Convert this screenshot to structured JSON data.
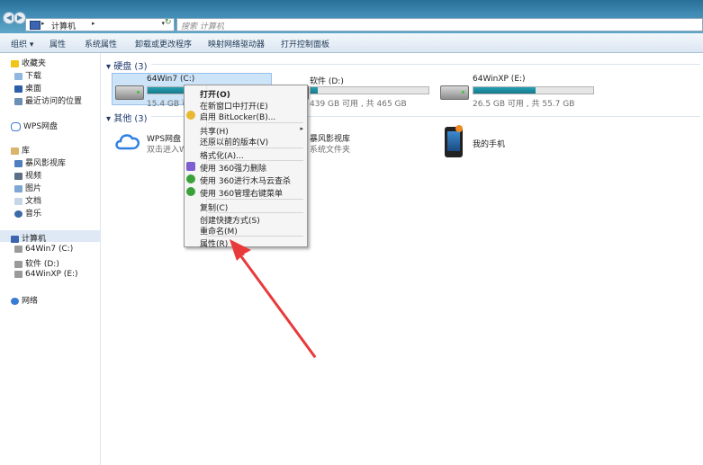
{
  "address": {
    "path_root": "计算机",
    "search_placeholder": "搜索 计算机"
  },
  "toolbar": {
    "organize": "组织",
    "properties": "属性",
    "system_properties": "系统属性",
    "uninstall": "卸载或更改程序",
    "map_drive": "映射网络驱动器",
    "control_panel": "打开控制面板"
  },
  "sidebar": {
    "favorites": "收藏夹",
    "downloads": "下载",
    "desktop": "桌面",
    "recent": "最近访问的位置",
    "wps_cloud": "WPS网盘",
    "libraries": "库",
    "storm_video": "暴风影视库",
    "videos": "视频",
    "pictures": "图片",
    "documents": "文档",
    "music": "音乐",
    "computer": "计算机",
    "drive_c": "64Win7  (C:)",
    "drive_d": "软件 (D:)",
    "drive_e": "64WinXP  (E:)",
    "network": "网络"
  },
  "main": {
    "hard_disks_header": "硬盘 (3)",
    "other_header": "其他 (3)",
    "drives": [
      {
        "name": "64Win7  (C:)",
        "free": "15.4 GB 可",
        "usage": 0.7
      },
      {
        "name": "软件 (D:)",
        "free": "439 GB 可用 , 共 465 GB",
        "usage": 0.06
      },
      {
        "name": "64WinXP  (E:)",
        "free": "26.5 GB 可用 , 共 55.7 GB",
        "usage": 0.52
      }
    ],
    "others": [
      {
        "name": "WPS网盘",
        "sub": "双击进入W"
      },
      {
        "name": "暴风影视库",
        "sub": "系统文件夹"
      },
      {
        "name": "我的手机",
        "sub": ""
      }
    ]
  },
  "context_menu": {
    "open": "打开(O)",
    "open_new_window": "在新窗口中打开(E)",
    "bitlocker": "启用 BitLocker(B)...",
    "share": "共享(H)",
    "restore": "还原以前的版本(V)",
    "format": "格式化(A)...",
    "force_delete": "使用 360强力删除",
    "trojan_scan": "使用 360进行木马云查杀",
    "manage_menu": "使用 360管理右键菜单",
    "copy": "复制(C)",
    "create_shortcut": "创建快捷方式(S)",
    "rename": "重命名(M)",
    "properties": "属性(R)"
  },
  "colors": {
    "accent_red": "#e83a3a",
    "drive_bar": "#1f8fa3",
    "selection": "#cde3f7"
  }
}
